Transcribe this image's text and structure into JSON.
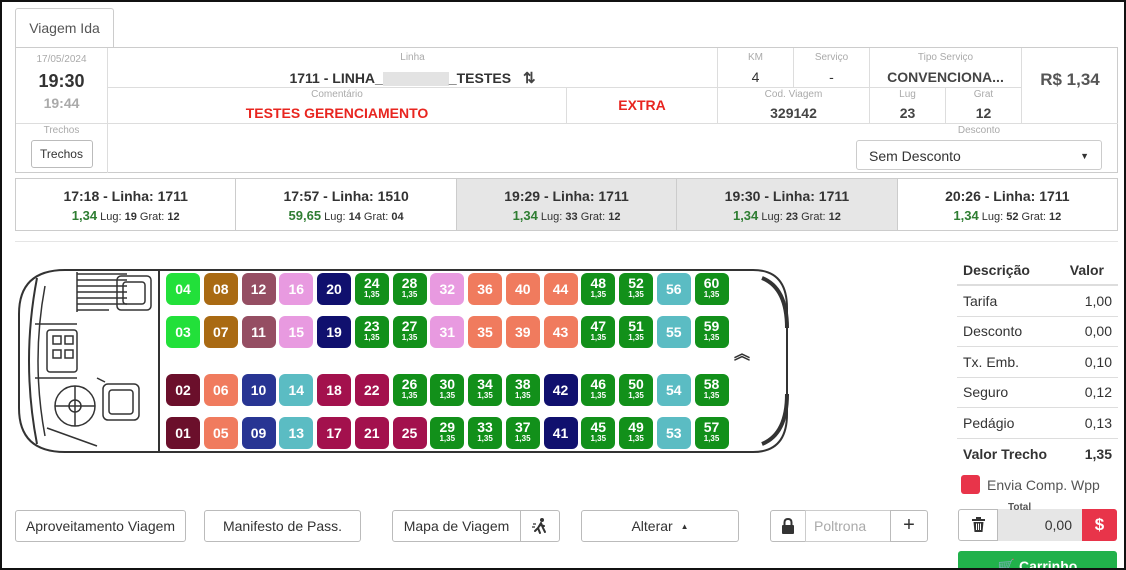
{
  "tab_label": "Viagem Ida",
  "info": {
    "date": "17/05/2024",
    "time": "19:30",
    "arrival": "19:44",
    "linha_label": "Linha",
    "linha_prefix": "1711 - LINHA_",
    "linha_suffix": "_TESTES",
    "km_label": "KM",
    "km": "4",
    "servico_label": "Serviço",
    "servico": "-",
    "tipo_label": "Tipo Serviço",
    "tipo": "CONVENCIONA...",
    "price": "R$ 1,34",
    "comentario_label": "Comentário",
    "comentario": "TESTES GERENCIAMENTO",
    "extra": "EXTRA",
    "cod_label": "Cod. Viagem",
    "cod": "329142",
    "lug_label": "Lug",
    "lug": "23",
    "grat_label": "Grat",
    "grat": "12",
    "trechos_label": "Trechos",
    "trechos_button": "Trechos",
    "desconto_label": "Desconto",
    "desconto_value": "Sem Desconto"
  },
  "trips": [
    {
      "title": "17:18 - Linha: 1711",
      "price": "1,34",
      "lug_txt": " Lug: ",
      "lug": "19",
      "grat_txt": " Grat: ",
      "grat": "12",
      "selected": false
    },
    {
      "title": "17:57 - Linha: 1510",
      "price": "59,65",
      "lug_txt": " Lug: ",
      "lug": "14",
      "grat_txt": " Grat: ",
      "grat": "04",
      "selected": false
    },
    {
      "title": "19:29 - Linha: 1711",
      "price": "1,34",
      "lug_txt": " Lug: ",
      "lug": "33",
      "grat_txt": " Grat: ",
      "grat": "12",
      "selected": true
    },
    {
      "title": "19:30 - Linha: 1711",
      "price": "1,34",
      "lug_txt": " Lug: ",
      "lug": "23",
      "grat_txt": " Grat: ",
      "grat": "12",
      "selected": true
    },
    {
      "title": "20:26 - Linha: 1711",
      "price": "1,34",
      "lug_txt": " Lug: ",
      "lug": "52",
      "grat_txt": " Grat: ",
      "grat": "12",
      "selected": false
    }
  ],
  "seat_price": "1,35",
  "seat_rows": [
    [
      {
        "n": "04",
        "c": "#22e03a",
        "p": false
      },
      {
        "n": "08",
        "c": "#a96a13",
        "p": false
      },
      {
        "n": "12",
        "c": "#954e63",
        "p": false
      },
      {
        "n": "16",
        "c": "#e89ae0",
        "p": false
      },
      {
        "n": "20",
        "c": "#10106e",
        "p": false
      },
      {
        "n": "24",
        "c": "#12901a",
        "p": true
      },
      {
        "n": "28",
        "c": "#12901a",
        "p": true
      },
      {
        "n": "32",
        "c": "#e89ae0",
        "p": false
      },
      {
        "n": "36",
        "c": "#f07b5e",
        "p": false
      },
      {
        "n": "40",
        "c": "#f07b5e",
        "p": false
      },
      {
        "n": "44",
        "c": "#f07b5e",
        "p": false
      },
      {
        "n": "48",
        "c": "#12901a",
        "p": true
      },
      {
        "n": "52",
        "c": "#12901a",
        "p": true
      },
      {
        "n": "56",
        "c": "#5bbcc3",
        "p": false
      },
      {
        "n": "60",
        "c": "#12901a",
        "p": true
      }
    ],
    [
      {
        "n": "03",
        "c": "#22e03a",
        "p": false
      },
      {
        "n": "07",
        "c": "#a96a13",
        "p": false
      },
      {
        "n": "11",
        "c": "#954e63",
        "p": false
      },
      {
        "n": "15",
        "c": "#e89ae0",
        "p": false
      },
      {
        "n": "19",
        "c": "#10106e",
        "p": false
      },
      {
        "n": "23",
        "c": "#12901a",
        "p": true
      },
      {
        "n": "27",
        "c": "#12901a",
        "p": true
      },
      {
        "n": "31",
        "c": "#e89ae0",
        "p": false
      },
      {
        "n": "35",
        "c": "#f07b5e",
        "p": false
      },
      {
        "n": "39",
        "c": "#f07b5e",
        "p": false
      },
      {
        "n": "43",
        "c": "#f07b5e",
        "p": false
      },
      {
        "n": "47",
        "c": "#12901a",
        "p": true
      },
      {
        "n": "51",
        "c": "#12901a",
        "p": true
      },
      {
        "n": "55",
        "c": "#5bbcc3",
        "p": false
      },
      {
        "n": "59",
        "c": "#12901a",
        "p": true
      }
    ],
    [
      {
        "n": "02",
        "c": "#6b0f2b",
        "p": false
      },
      {
        "n": "06",
        "c": "#f07b5e",
        "p": false
      },
      {
        "n": "10",
        "c": "#283593",
        "p": false
      },
      {
        "n": "14",
        "c": "#5bbcc3",
        "p": false
      },
      {
        "n": "18",
        "c": "#a3114d",
        "p": false
      },
      {
        "n": "22",
        "c": "#a3114d",
        "p": false
      },
      {
        "n": "26",
        "c": "#12901a",
        "p": true
      },
      {
        "n": "30",
        "c": "#12901a",
        "p": true
      },
      {
        "n": "34",
        "c": "#12901a",
        "p": true
      },
      {
        "n": "38",
        "c": "#12901a",
        "p": true
      },
      {
        "n": "42",
        "c": "#10106e",
        "p": false
      },
      {
        "n": "46",
        "c": "#12901a",
        "p": true
      },
      {
        "n": "50",
        "c": "#12901a",
        "p": true
      },
      {
        "n": "54",
        "c": "#5bbcc3",
        "p": false
      },
      {
        "n": "58",
        "c": "#12901a",
        "p": true
      }
    ],
    [
      {
        "n": "01",
        "c": "#6b0f2b",
        "p": false
      },
      {
        "n": "05",
        "c": "#f07b5e",
        "p": false
      },
      {
        "n": "09",
        "c": "#283593",
        "p": false
      },
      {
        "n": "13",
        "c": "#5bbcc3",
        "p": false
      },
      {
        "n": "17",
        "c": "#a3114d",
        "p": false
      },
      {
        "n": "21",
        "c": "#a3114d",
        "p": false
      },
      {
        "n": "25",
        "c": "#a3114d",
        "p": false
      },
      {
        "n": "29",
        "c": "#12901a",
        "p": true
      },
      {
        "n": "33",
        "c": "#12901a",
        "p": true
      },
      {
        "n": "37",
        "c": "#12901a",
        "p": true
      },
      {
        "n": "41",
        "c": "#10106e",
        "p": false
      },
      {
        "n": "45",
        "c": "#12901a",
        "p": true
      },
      {
        "n": "49",
        "c": "#12901a",
        "p": true
      },
      {
        "n": "53",
        "c": "#5bbcc3",
        "p": false
      },
      {
        "n": "57",
        "c": "#12901a",
        "p": true
      }
    ]
  ],
  "summary": {
    "head_desc": "Descrição",
    "head_val": "Valor",
    "rows": [
      {
        "label": "Tarifa",
        "value": "1,00"
      },
      {
        "label": "Desconto",
        "value": "0,00"
      },
      {
        "label": "Tx. Emb.",
        "value": "0,10"
      },
      {
        "label": "Seguro",
        "value": "0,12"
      },
      {
        "label": "Pedágio",
        "value": "0,13"
      }
    ],
    "total_label": "Valor Trecho",
    "total_value": "1,35"
  },
  "wpp_label": "Envia Comp. Wpp",
  "buttons": {
    "aproveitamento": "Aproveitamento Viagem",
    "manifesto": "Manifesto de Pass.",
    "mapa": "Mapa de Viagem",
    "alterar": "Alterar",
    "poltrona_placeholder": "Poltrona",
    "total_label": "Total",
    "total_value": "0,00",
    "dollar": "$",
    "carrinho": "Carrinho"
  },
  "icons": {
    "refresh": "refresh-icon",
    "caret": "caret-down-icon",
    "lock": "lock-icon",
    "plus": "plus-icon",
    "trash": "trash-icon",
    "cart": "cart-icon",
    "walk": "walking-person-icon",
    "chevron": "double-chevron-up-icon"
  }
}
